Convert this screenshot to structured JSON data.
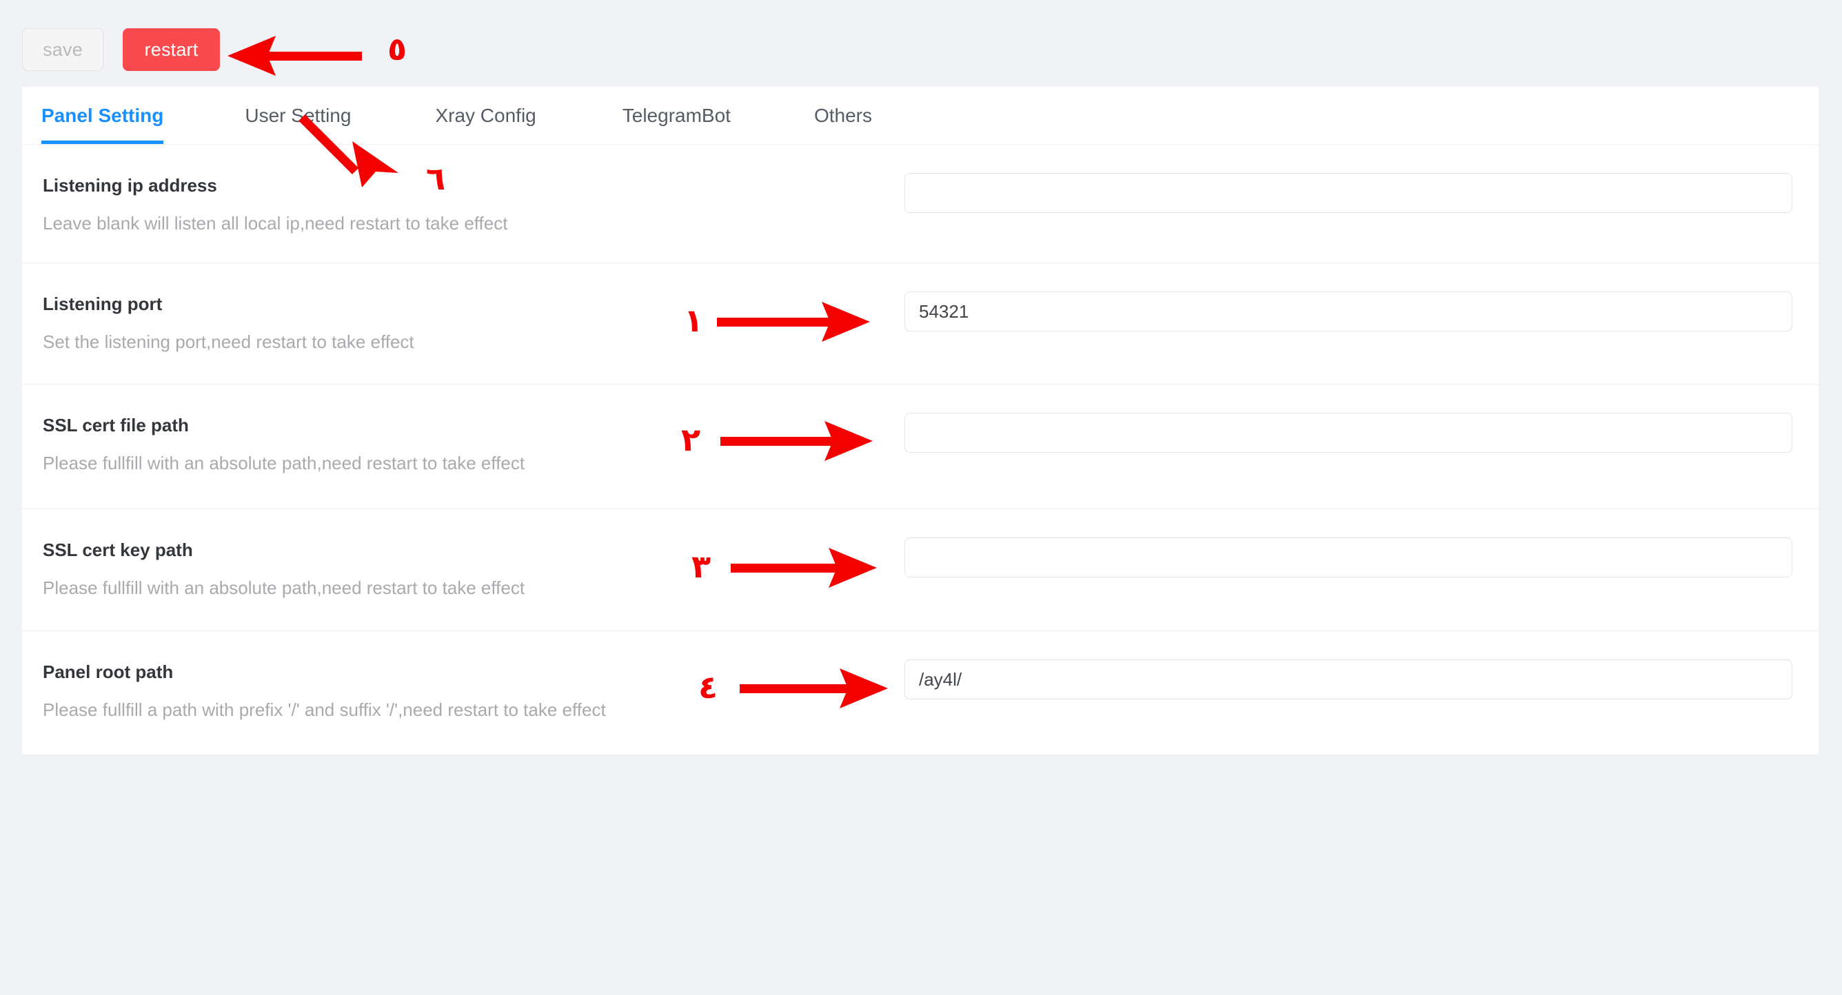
{
  "toolbar": {
    "save_label": "save",
    "restart_label": "restart"
  },
  "tabs": [
    {
      "label": "Panel Setting",
      "active": true
    },
    {
      "label": "User Setting",
      "active": false
    },
    {
      "label": "Xray Config",
      "active": false
    },
    {
      "label": "TelegramBot",
      "active": false
    },
    {
      "label": "Others",
      "active": false
    }
  ],
  "settings": [
    {
      "title": "Listening ip address",
      "desc": "Leave blank will listen all local ip,need restart to take effect",
      "value": "",
      "placeholder": ""
    },
    {
      "title": "Listening port",
      "desc": "Set the listening port,need restart to take effect",
      "value": "54321",
      "placeholder": ""
    },
    {
      "title": "SSL cert file path",
      "desc": "Please fullfill with an absolute path,need restart to take effect",
      "value": "",
      "placeholder": ""
    },
    {
      "title": "SSL cert key path",
      "desc": "Please fullfill with an absolute path,need restart to take effect",
      "value": "",
      "placeholder": ""
    },
    {
      "title": "Panel root path",
      "desc": "Please fullfill a path with prefix '/' and suffix '/',need restart to take effect",
      "value": "/ay4l/",
      "placeholder": ""
    }
  ],
  "annotations": {
    "color": "#f40000",
    "markers": [
      {
        "number": "١",
        "target": "listening-port-input"
      },
      {
        "number": "٢",
        "target": "ssl-cert-file-path-input"
      },
      {
        "number": "٣",
        "target": "ssl-cert-key-path-input"
      },
      {
        "number": "٤",
        "target": "panel-root-path-input"
      },
      {
        "number": "٥",
        "target": "restart-button"
      },
      {
        "number": "٦",
        "target": "user-setting-tab"
      }
    ]
  },
  "theme": {
    "accent": "#1890ff",
    "danger": "#fb4a4d",
    "background": "#f0f2f5"
  }
}
